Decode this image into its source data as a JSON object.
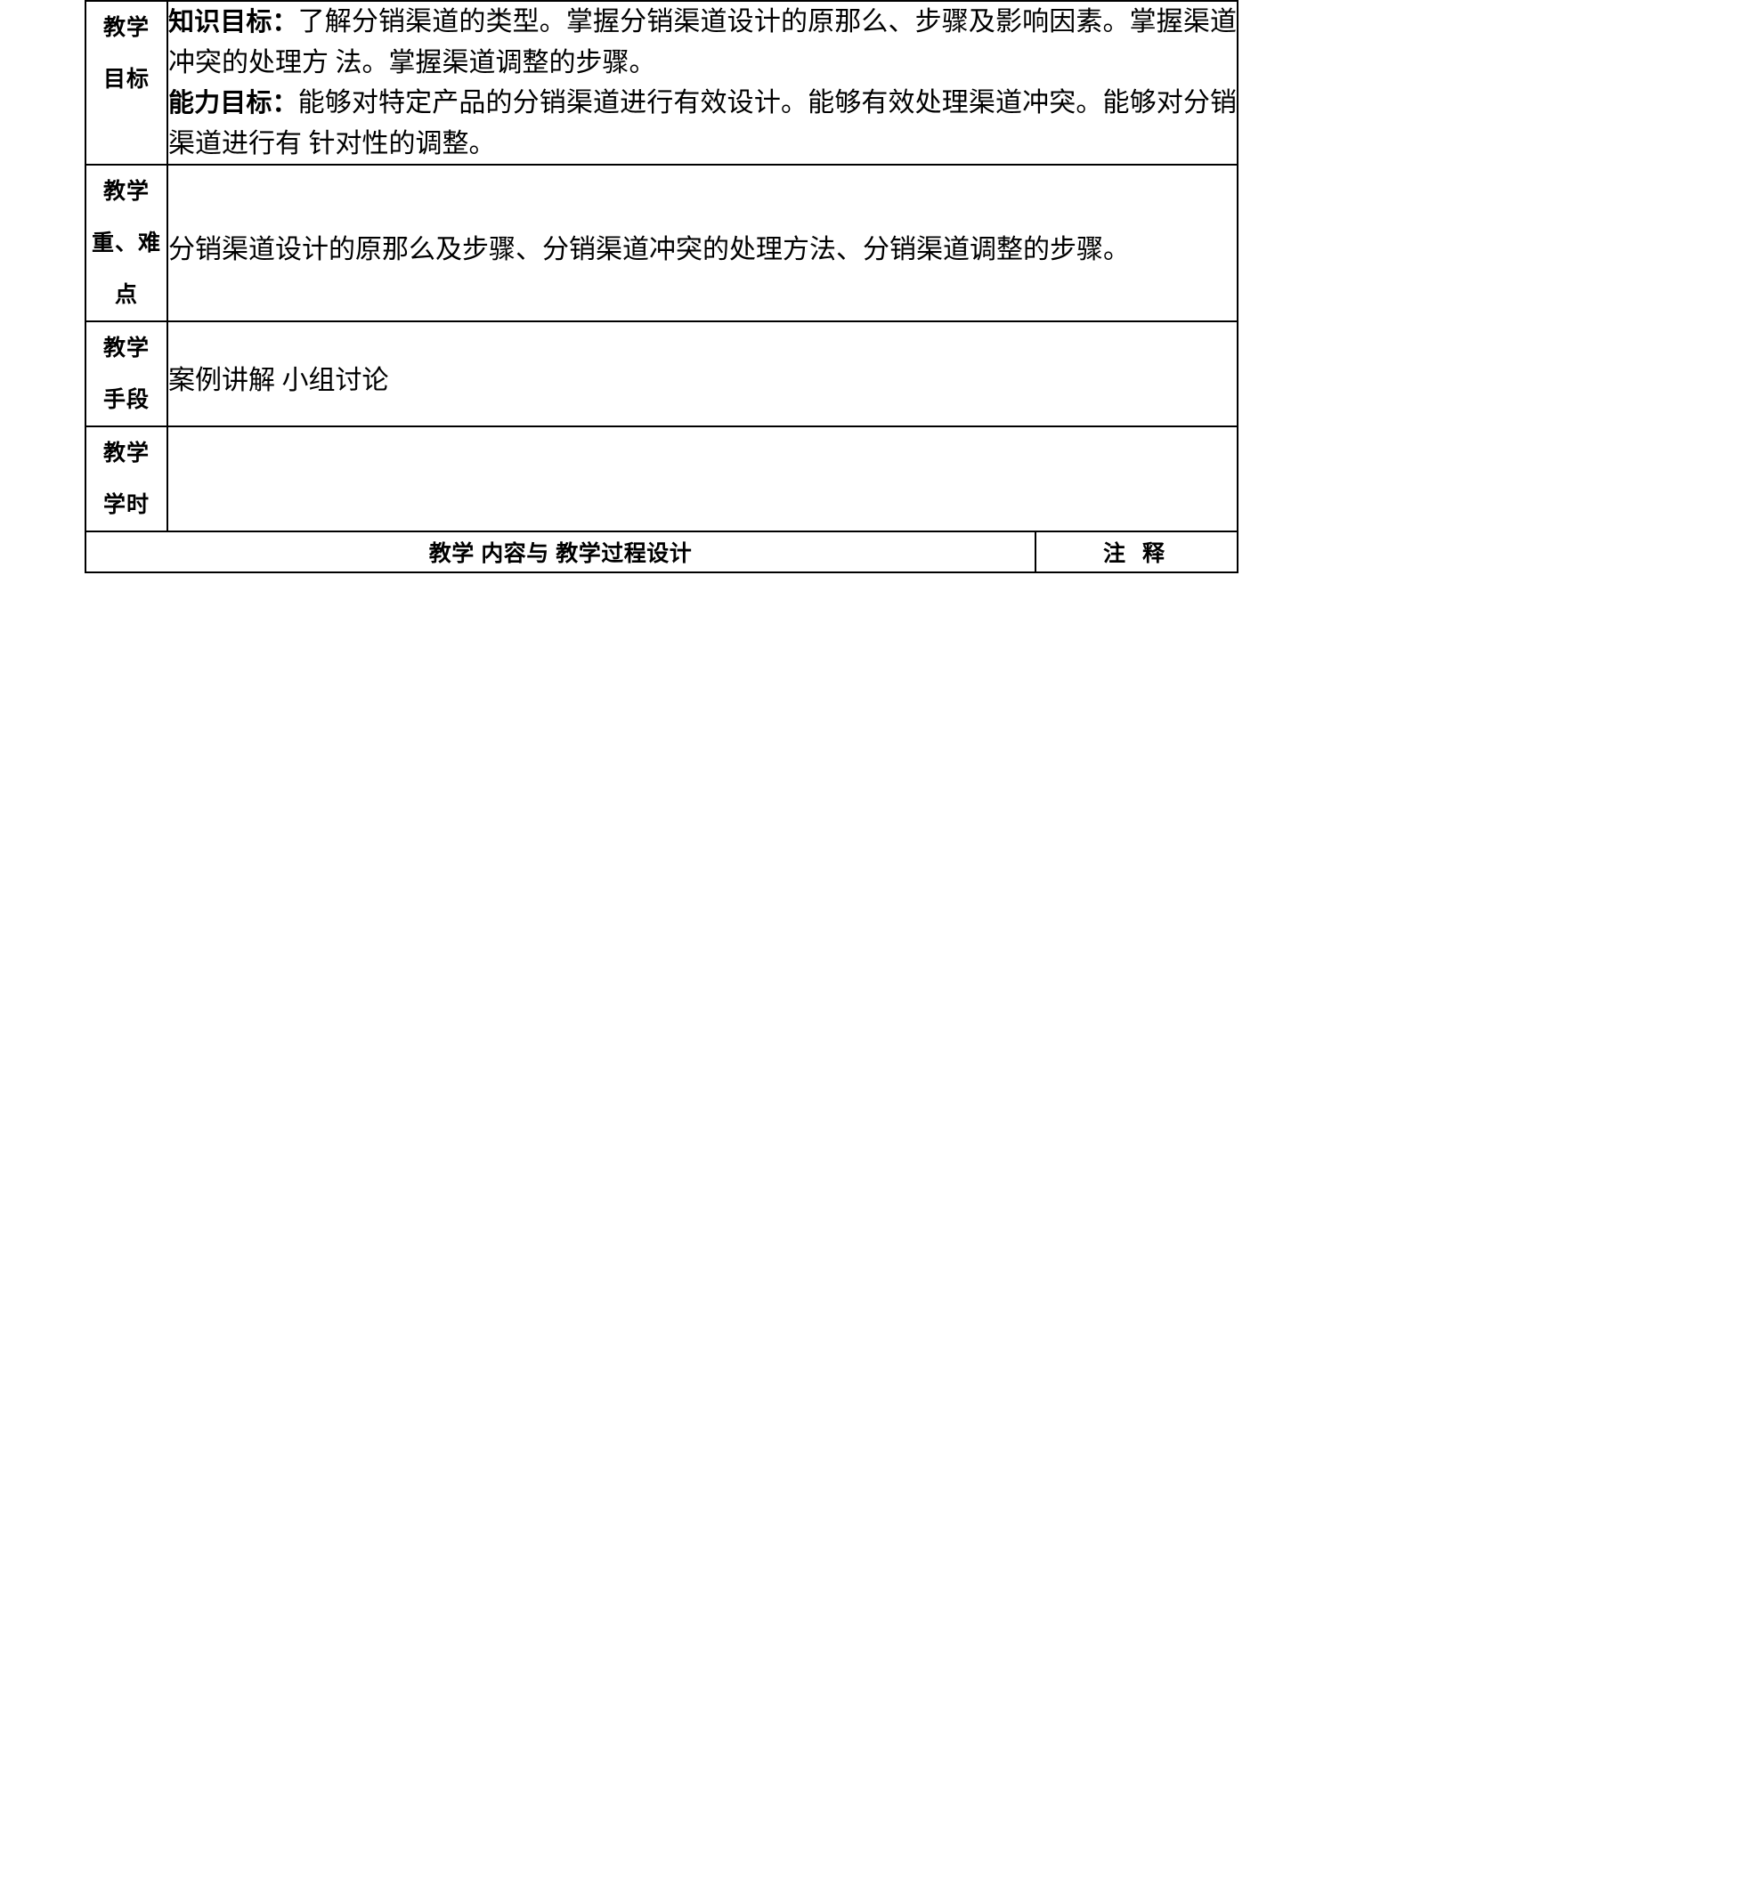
{
  "document": {
    "type": "lesson-plan-table",
    "rows": [
      {
        "label_lines": [
          "教学",
          "目标"
        ],
        "paragraphs": [
          {
            "lead": "知识目标：",
            "text": "了解分销渠道的类型。掌握分销渠道设计的原那么、步骤及影响因素。掌握渠道冲突的处理方 法。掌握渠道调整的步骤。"
          },
          {
            "lead": "能力目标：",
            "text": "能够对特定产品的分销渠道进行有效设计。能够有效处理渠道冲突。能够对分销渠道进行有 针对性的调整。"
          }
        ]
      },
      {
        "label_lines": [
          "教学",
          "重、难",
          "点"
        ],
        "paragraphs": [
          {
            "lead": "",
            "text": "分销渠道设计的原那么及步骤、分销渠道冲突的处理方法、分销渠道调整的步骤。"
          }
        ]
      },
      {
        "label_lines": [
          "教学",
          "手段"
        ],
        "paragraphs": [
          {
            "lead": "",
            "text": "案例讲解  小组讨论"
          }
        ]
      },
      {
        "label_lines": [
          "教学",
          "学时"
        ],
        "paragraphs": [
          {
            "lead": "",
            "text": ""
          }
        ]
      }
    ],
    "footer": {
      "content_heading": "教学  内容与  教学过程设计",
      "notes_heading": "注 释"
    }
  }
}
